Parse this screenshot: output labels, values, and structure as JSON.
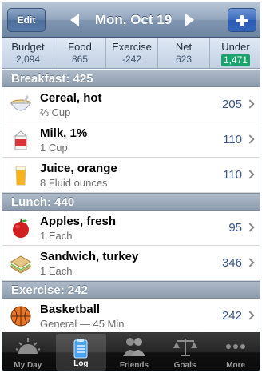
{
  "navbar": {
    "edit_label": "Edit",
    "date": "Mon, Oct 19",
    "add_icon": "plus-icon"
  },
  "summary": [
    {
      "label": "Budget",
      "value": "2,094"
    },
    {
      "label": "Food",
      "value": "865"
    },
    {
      "label": "Exercise",
      "value": "-242"
    },
    {
      "label": "Net",
      "value": "623"
    },
    {
      "label": "Under",
      "value": "1,471",
      "highlight": "#1aa46b"
    }
  ],
  "sections": [
    {
      "header": "Breakfast: 425",
      "items": [
        {
          "name": "Cereal, hot",
          "detail": "⅔ Cup",
          "calories": "205",
          "icon": "cereal-bowl-icon"
        },
        {
          "name": "Milk, 1%",
          "detail": "1 Cup",
          "calories": "110",
          "icon": "milk-carton-icon"
        },
        {
          "name": "Juice, orange",
          "detail": "8 Fluid ounces",
          "calories": "110",
          "icon": "juice-glass-icon"
        }
      ]
    },
    {
      "header": "Lunch: 440",
      "items": [
        {
          "name": "Apples, fresh",
          "detail": "1 Each",
          "calories": "95",
          "icon": "apple-icon"
        },
        {
          "name": "Sandwich, turkey",
          "detail": "1 Each",
          "calories": "346",
          "icon": "sandwich-icon"
        }
      ]
    },
    {
      "header": "Exercise: 242",
      "items": [
        {
          "name": "Basketball",
          "detail": "General — 45 Min",
          "calories": "242",
          "icon": "basketball-icon"
        }
      ]
    }
  ],
  "tabs": [
    {
      "label": "My Day",
      "icon": "sunrise-icon",
      "active": false
    },
    {
      "label": "Log",
      "icon": "clipboard-icon",
      "active": true
    },
    {
      "label": "Friends",
      "icon": "friends-icon",
      "active": false
    },
    {
      "label": "Goals",
      "icon": "scale-icon",
      "active": false
    },
    {
      "label": "More",
      "icon": "more-dots-icon",
      "active": false
    }
  ]
}
